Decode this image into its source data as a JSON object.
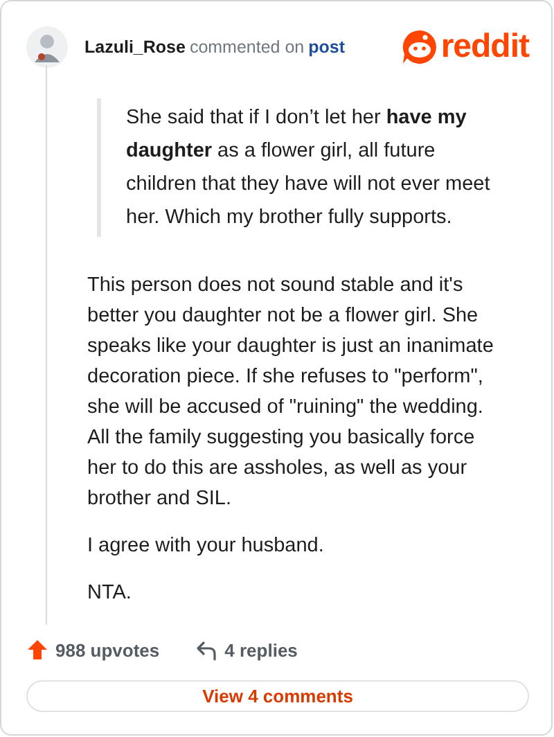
{
  "header": {
    "username": "Lazuli_Rose",
    "action": "commented on",
    "link": "post",
    "logo": "reddit"
  },
  "quote": "She said that if I don’t let her **have my daughter** as a flower girl, all future children that they have will not ever meet her. Which my brother fully supports.",
  "paragraphs": [
    "This person does not sound stable and it's better you daughter not be a flower girl. She speaks like your daughter is just an inanimate decoration piece. If she refuses to \"perform\", she will be accused of \"ruining\" the wedding. All the family suggesting you basically force her to do this are assholes, as well as your brother and SIL.",
    "I agree with your husband.",
    "NTA."
  ],
  "footer": {
    "upvotes": "988 upvotes",
    "replies": "4 replies",
    "button": "View 4 comments"
  }
}
